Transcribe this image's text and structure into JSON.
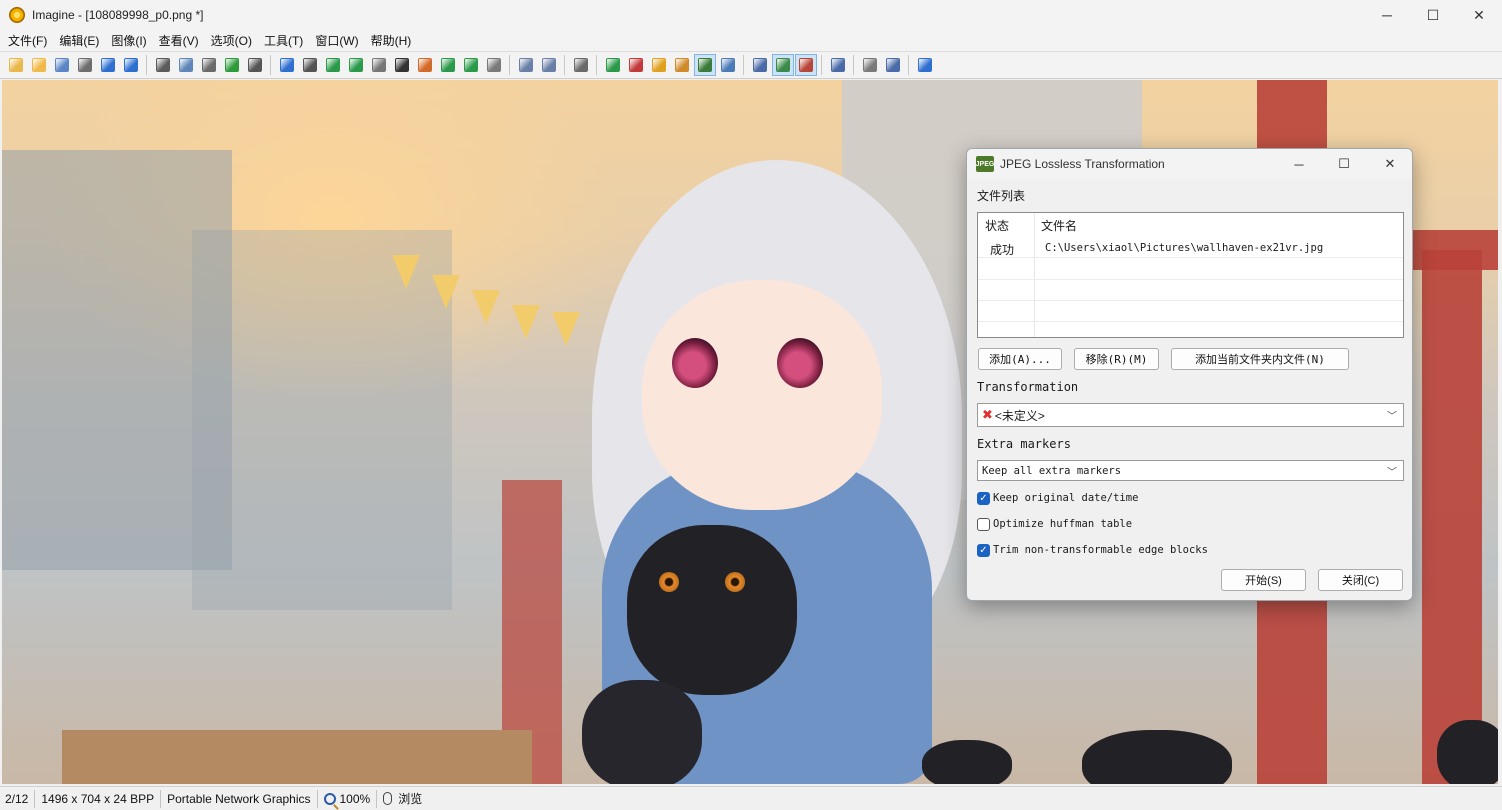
{
  "window": {
    "title": "Imagine - [108089998_p0.png *]",
    "controls": {
      "minimize": "─",
      "maximize": "☐",
      "close": "✕"
    }
  },
  "menu": [
    "文件(F)",
    "编辑(E)",
    "图像(I)",
    "查看(V)",
    "选项(O)",
    "工具(T)",
    "窗口(W)",
    "帮助(H)"
  ],
  "toolbar": {
    "groups": [
      [
        {
          "icon": "new-icon",
          "color": "#e8b84a"
        },
        {
          "icon": "open-folder-icon",
          "color": "#f0b94a"
        },
        {
          "icon": "save-icon",
          "color": "#5a86c6"
        },
        {
          "icon": "print-icon",
          "color": "#6e6e6e"
        },
        {
          "icon": "back-arrow-icon",
          "color": "#2f6fd0"
        },
        {
          "icon": "forward-arrow-icon",
          "color": "#2f6fd0"
        }
      ],
      [
        {
          "icon": "cut-icon",
          "color": "#5b5b5b"
        },
        {
          "icon": "copy-icon",
          "color": "#5f86b8"
        },
        {
          "icon": "paste-icon",
          "color": "#6a6a6a"
        },
        {
          "icon": "undo-icon",
          "color": "#2e9b3a"
        },
        {
          "icon": "redo-icon",
          "color": "#555555"
        }
      ],
      [
        {
          "icon": "info-icon",
          "color": "#2f6fd0"
        },
        {
          "icon": "camera-icon",
          "color": "#555555"
        },
        {
          "icon": "resize-icon",
          "color": "#2a9a4a"
        },
        {
          "icon": "crop-icon",
          "color": "#2a9a4a"
        },
        {
          "icon": "grayscale-icon",
          "color": "#777777"
        },
        {
          "icon": "negative-icon",
          "color": "#333333"
        },
        {
          "icon": "effects-icon",
          "color": "#d46a2a"
        },
        {
          "icon": "rotate-down-icon",
          "color": "#2a9a4a"
        },
        {
          "icon": "rotate-icon",
          "color": "#2a9a4a"
        },
        {
          "icon": "batch-icon",
          "color": "#7a7a7a"
        }
      ],
      [
        {
          "icon": "zoom-window-left-icon",
          "color": "#6a7fa8"
        },
        {
          "icon": "zoom-window-right-icon",
          "color": "#6a7fa8"
        }
      ],
      [
        {
          "icon": "lossless-icon",
          "color": "#6a6a6a"
        }
      ],
      [
        {
          "icon": "zoom-in-icon",
          "color": "#2a9a4a"
        },
        {
          "icon": "zoom-out-icon",
          "color": "#c43a3a"
        },
        {
          "icon": "magic-wand-icon",
          "color": "#e0a020"
        },
        {
          "icon": "fit-window-icon",
          "color": "#d08a2a"
        },
        {
          "icon": "actual-size-icon",
          "color": "#3a7a3a",
          "pressed": true
        },
        {
          "icon": "fit-width-icon",
          "color": "#4a7ab8"
        }
      ],
      [
        {
          "icon": "monitor-icon",
          "color": "#4a6aa8"
        },
        {
          "icon": "fullscreen-icon",
          "color": "#3a8a4a",
          "pressed": true
        },
        {
          "icon": "slideshow-icon",
          "color": "#b8453a",
          "pressed": true
        }
      ],
      [
        {
          "icon": "settings-wrench-icon",
          "color": "#4a6aa8"
        }
      ],
      [
        {
          "icon": "thumbnails-icon",
          "color": "#7a7a7a"
        },
        {
          "icon": "tile-windows-icon",
          "color": "#4a6aa8"
        }
      ],
      [
        {
          "icon": "help-icon",
          "color": "#2f6fd0"
        }
      ]
    ]
  },
  "status": {
    "index": "2/12",
    "dimensions": "1496 x 704 x 24 BPP",
    "format": "Portable Network Graphics",
    "zoom_icon": "magnifier-icon",
    "zoom": "100%",
    "mode_icon": "mouse-icon",
    "mode": "浏览"
  },
  "dialog": {
    "title": "JPEG Lossless Transformation",
    "icon_text": "JPEG",
    "controls": {
      "minimize": "─",
      "maximize": "☐",
      "close": "✕"
    },
    "file_list_label": "文件列表",
    "columns": {
      "status": "状态",
      "filename": "文件名"
    },
    "files": [
      {
        "status": "成功",
        "filename": "C:\\Users\\xiaol\\Pictures\\wallhaven-ex21vr.jpg"
      }
    ],
    "buttons": {
      "add": "添加(A)...",
      "remove": "移除(R)(M)",
      "add_folder": "添加当前文件夹内文件(N)",
      "start": "开始(S)",
      "close": "关闭(C)"
    },
    "transformation_label": "Transformation",
    "transformation_value": "<未定义>",
    "extra_markers_label": "Extra markers",
    "extra_markers_value": "Keep all extra markers",
    "options": [
      {
        "label": "Keep original date/time",
        "checked": true
      },
      {
        "label": "Optimize huffman table",
        "checked": false
      },
      {
        "label": "Trim non-transformable edge blocks",
        "checked": true
      }
    ],
    "accent_color": "#1a63c4",
    "error_color": "#e03030"
  }
}
